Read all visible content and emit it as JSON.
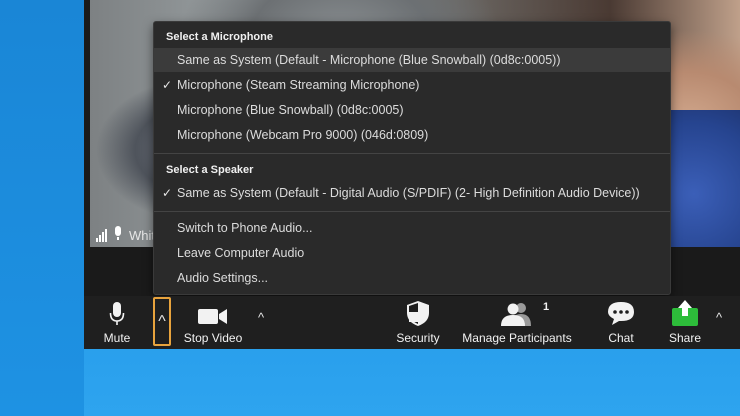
{
  "video": {
    "participant_name": "Whitson Gordon"
  },
  "audio_menu": {
    "microphone_header": "Select a Microphone",
    "microphones": [
      {
        "label": "Same as System (Default - Microphone (Blue Snowball) (0d8c:0005))",
        "selected": false
      },
      {
        "label": "Microphone (Steam Streaming Microphone)",
        "selected": true
      },
      {
        "label": "Microphone (Blue Snowball) (0d8c:0005)",
        "selected": false
      },
      {
        "label": "Microphone (Webcam Pro 9000) (046d:0809)",
        "selected": false
      }
    ],
    "speaker_header": "Select a Speaker",
    "speakers": [
      {
        "label": "Same as System (Default - Digital Audio (S/PDIF) (2- High Definition Audio Device))",
        "selected": true
      }
    ],
    "actions": [
      "Switch to Phone Audio...",
      "Leave Computer Audio",
      "Audio Settings..."
    ],
    "check_glyph": "✓"
  },
  "toolbar": {
    "mute_label": "Mute",
    "stop_video_label": "Stop Video",
    "security_label": "Security",
    "manage_participants_label": "Manage Participants",
    "participant_count": "1",
    "chat_label": "Chat",
    "share_label": "Share",
    "caret_glyph": "^",
    "share_color": "#2dbd3a"
  }
}
